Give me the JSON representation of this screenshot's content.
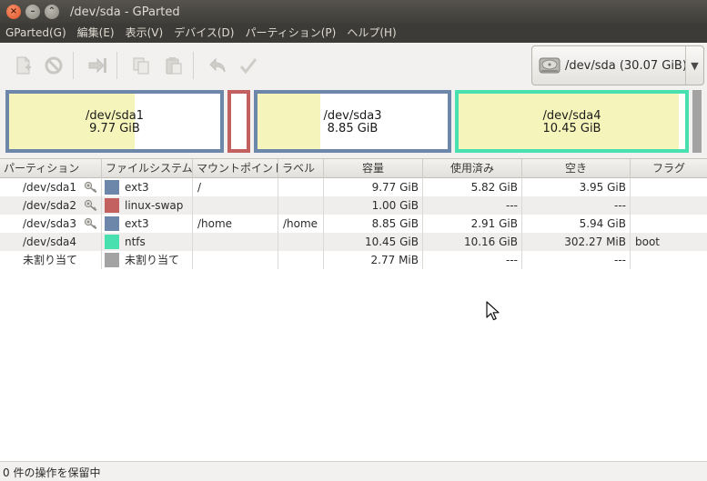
{
  "window": {
    "title": "/dev/sda - GParted",
    "close_glyph": "×",
    "minimize_glyph": "–",
    "maximize_glyph": "⌃"
  },
  "menu": [
    "GParted(G)",
    "編集(E)",
    "表示(V)",
    "デバイス(D)",
    "パーティション(P)",
    "ヘルプ(H)"
  ],
  "toolbar": {
    "icons": [
      "new-partition-icon",
      "delete-icon",
      "resize-move-icon",
      "copy-icon",
      "paste-icon",
      "undo-icon",
      "apply-icon"
    ],
    "device_selector": "/dev/sda   (30.07 GiB)",
    "device_arrow": "▼"
  },
  "partition_map": [
    {
      "name": "/dev/sda1",
      "size": "9.77 GiB",
      "used_fraction": 0.596,
      "filesystem": "ext3",
      "color": "#6c87a9"
    },
    {
      "name": "",
      "size": "",
      "used_fraction": 0,
      "filesystem": "linux-swap",
      "color": "#c36060"
    },
    {
      "name": "/dev/sda3",
      "size": "8.85 GiB",
      "used_fraction": 0.329,
      "filesystem": "ext3",
      "color": "#6c87a9"
    },
    {
      "name": "/dev/sda4",
      "size": "10.45 GiB",
      "used_fraction": 0.972,
      "filesystem": "ntfs",
      "color": "#49e0b0"
    },
    {
      "name": "",
      "size": "",
      "used_fraction": 0,
      "filesystem": "unallocated",
      "color": "#a3a3a3"
    }
  ],
  "table": {
    "headers": [
      "パーティション",
      "ファイルシステム",
      "マウントポイント",
      "ラベル",
      "容量",
      "使用済み",
      "空き",
      "フラグ"
    ],
    "rows": [
      {
        "partition": "/dev/sda1",
        "locked": true,
        "fs_color": "#6c87a9",
        "filesystem": "ext3",
        "mount": "/",
        "label": "",
        "size": "9.77 GiB",
        "used": "5.82 GiB",
        "free": "3.95 GiB",
        "flags": ""
      },
      {
        "partition": "/dev/sda2",
        "locked": true,
        "fs_color": "#c36060",
        "filesystem": "linux-swap",
        "mount": "",
        "label": "",
        "size": "1.00 GiB",
        "used": "---",
        "free": "---",
        "flags": ""
      },
      {
        "partition": "/dev/sda3",
        "locked": true,
        "fs_color": "#6c87a9",
        "filesystem": "ext3",
        "mount": "/home",
        "label": "/home",
        "size": "8.85 GiB",
        "used": "2.91 GiB",
        "free": "5.94 GiB",
        "flags": ""
      },
      {
        "partition": "/dev/sda4",
        "locked": false,
        "fs_color": "#49e0b0",
        "filesystem": "ntfs",
        "mount": "",
        "label": "",
        "size": "10.45 GiB",
        "used": "10.16 GiB",
        "free": "302.27 MiB",
        "flags": "boot"
      },
      {
        "partition": "未割り当て",
        "locked": false,
        "fs_color": "#a3a3a3",
        "filesystem": "未割り当て",
        "mount": "",
        "label": "",
        "size": "2.77 MiB",
        "used": "---",
        "free": "---",
        "flags": ""
      }
    ]
  },
  "status": "0 件の操作を保留中"
}
